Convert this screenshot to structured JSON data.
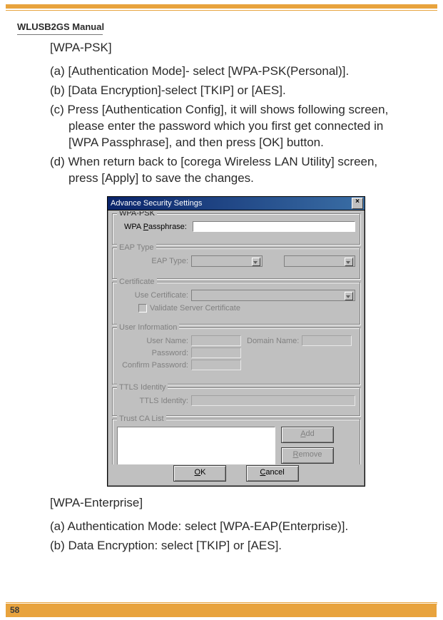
{
  "doc": {
    "manual_title": "WLUSB2GS Manual",
    "page_number": "58"
  },
  "section1": {
    "heading": "[WPA-PSK]",
    "items": {
      "a": "(a) [Authentication Mode]- select [WPA-PSK(Personal)].",
      "b": "(b) [Data Encryption]-select [TKIP] or [AES].",
      "c": "(c) Press [Authentication Conﬁg], it will shows following screen, please enter the password which you ﬁrst get connected in [WPA Passphrase], and then press [OK] button.",
      "d": "(d) When return back to [corega Wireless LAN Utility] screen, press [Apply] to save the changes."
    }
  },
  "section2": {
    "heading": "[WPA-Enterprise]",
    "items": {
      "a": "(a) Authentication Mode: select [WPA-EAP(Enterprise)].",
      "b": "(b) Data Encryption: select [TKIP] or [AES]."
    }
  },
  "dialog": {
    "title": "Advance Security Settings",
    "close_symbol": "×",
    "groups": {
      "wpa_psk": {
        "legend": "WPA-PSK",
        "label_prefix": "WPA ",
        "label_underlined": "P",
        "label_suffix": "assphrase:"
      },
      "eap_type": {
        "legend": "EAP Type",
        "label": "EAP Type:"
      },
      "certificate": {
        "legend": "Certificate",
        "label": "Use Certificate:",
        "check_label": "Validate Server Certificate"
      },
      "user_info": {
        "legend": "User Information",
        "name_label": "User Name:",
        "domain_label": "Domain Name:",
        "pw_label": "Password:",
        "confirm_label": "Confirm Password:"
      },
      "ttls": {
        "legend": "TTLS Identity",
        "label": "TTLS Identity:"
      },
      "trust_ca": {
        "legend": "Trust CA List"
      }
    },
    "buttons": {
      "add": "Add",
      "remove": "Remove",
      "ok": "OK",
      "cancel": "Cancel"
    }
  }
}
